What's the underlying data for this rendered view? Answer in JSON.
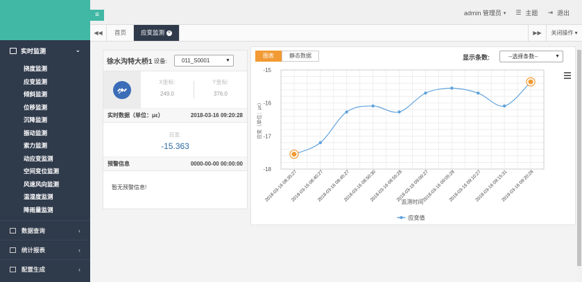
{
  "sidebar": {
    "active_group": "实时监测",
    "sub_items": [
      "挠度监测",
      "应变监测",
      "倾斜监测",
      "位移监测",
      "沉降监测",
      "振动监测",
      "索力监测",
      "动应变监测",
      "空间变位监测",
      "风速风向监测",
      "温湿度监测",
      "降雨量监测"
    ],
    "groups": [
      {
        "label": "数据查询"
      },
      {
        "label": "统计报表"
      },
      {
        "label": "配置生成"
      }
    ]
  },
  "topbar": {
    "user": "admin 管理员",
    "theme": "主题",
    "logout": "退出"
  },
  "tabs": {
    "home": "首页",
    "active": "应变监测",
    "close_ops": "关闭操作"
  },
  "left": {
    "bridge_name": "徐水沟特大桥1",
    "device_label": "设备:",
    "device_value": "011_S0001",
    "x_label": "X坐标:",
    "x_value": "249.0",
    "y_label": "Y坐标:",
    "y_value": "376.0",
    "realtime_label": "实时数据（单位：με）",
    "realtime_time": "2018-03-16 09:20:28",
    "strain_label": "应变:",
    "strain_value": "-15.363",
    "alarm_label": "预警信息",
    "alarm_time": "0000-00-00 00:00:00",
    "alarm_msg": "暂无预警信息!"
  },
  "right": {
    "btn_chart": "图表",
    "btn_static": "静态数据",
    "count_label": "显示条数:",
    "count_value": "--选择条数--"
  },
  "chart_data": {
    "type": "line",
    "x": [
      "2018-03-16 08:35:27",
      "2018-03-16 08:40:27",
      "2018-03-16 08:45:27",
      "2018-03-16 08:50:30",
      "2018-03-16 08:55:28",
      "2018-03-16 09:00:27",
      "2018-03-16 09:05:28",
      "2018-03-16 09:10:27",
      "2018-03-16 09:15:31",
      "2018-03-16 09:20:28"
    ],
    "series": [
      {
        "name": "应变值",
        "values": [
          -17.55,
          -17.2,
          -16.27,
          -16.09,
          -16.27,
          -15.7,
          -15.55,
          -15.7,
          -16.09,
          -15.36
        ]
      }
    ],
    "ylabel": "应变（单位：με）",
    "xlabel": "监测时间",
    "yticks": [
      "-15",
      "-16",
      "-17",
      "-18"
    ],
    "ylim": [
      -18,
      -15
    ],
    "legend": "bottom",
    "grid": true,
    "line_color": "#5fa2dd",
    "marker_color": "#f29a34"
  }
}
